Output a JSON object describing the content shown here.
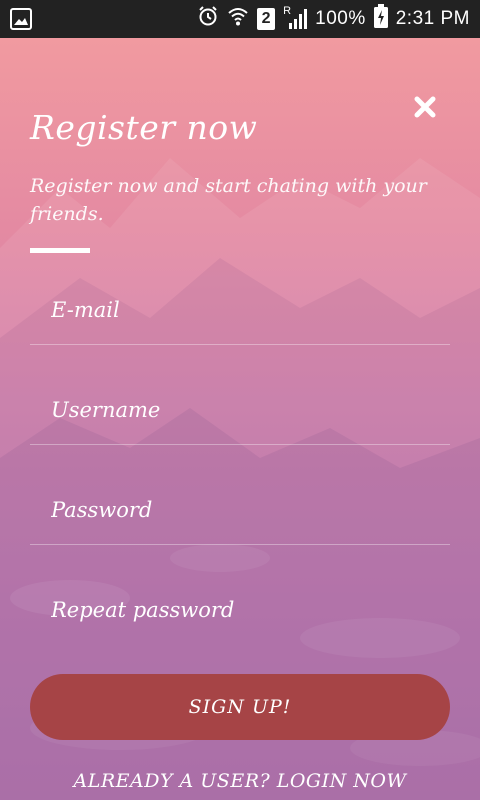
{
  "status_bar": {
    "sim_number": "2",
    "roaming_indicator": "R",
    "battery": "100%",
    "time": "2:31 PM",
    "icons": [
      "image-notification-icon",
      "alarm-icon",
      "wifi-icon",
      "sim-icon",
      "signal-icon",
      "battery-charging-icon"
    ]
  },
  "register": {
    "close_icon": "close-icon",
    "title": "Register now",
    "subtitle": "Register now and start chating with your friends.",
    "fields": {
      "email_placeholder": "E-mail",
      "username_placeholder": "Username",
      "password_placeholder": "Password",
      "repeat_password_placeholder": "Repeat password"
    },
    "signup_label": "SIGN UP!",
    "login_link": "ALREADY A USER? LOGIN NOW"
  },
  "colors": {
    "status_bar_bg": "#222222",
    "gradient_top": "#f19aa0",
    "gradient_bottom": "#b06fae",
    "signup_button": "#a64446",
    "text": "#ffffff"
  }
}
